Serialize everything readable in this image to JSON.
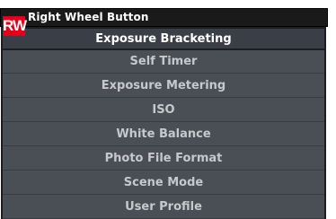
{
  "header": {
    "title": "Right Wheel Button"
  },
  "badge": {
    "label": "RW"
  },
  "menu": {
    "items": [
      {
        "label": "Exposure Bracketing",
        "selected": true
      },
      {
        "label": "Self Timer"
      },
      {
        "label": "Exposure Metering"
      },
      {
        "label": "ISO"
      },
      {
        "label": "White Balance"
      },
      {
        "label": "Photo File Format"
      },
      {
        "label": "Scene Mode"
      },
      {
        "label": "User Profile"
      }
    ]
  },
  "colors": {
    "header_bg": "#1a1a1a",
    "menu_bg": "#4a4f56",
    "selected_bg": "#3a3f47",
    "badge_bg": "#e3001b",
    "text": "#c6c8cb",
    "selected_text": "#ffffff"
  }
}
